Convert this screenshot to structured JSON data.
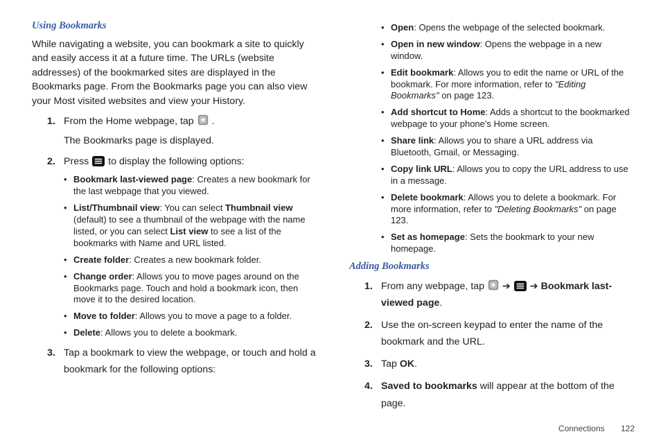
{
  "left": {
    "heading": "Using Bookmarks",
    "intro": "While navigating a website, you can bookmark a site to quickly and easily access it at a future time. The URLs (website addresses) of the bookmarked sites are displayed in the Bookmarks page. From the Bookmarks page you can also view your Most visited websites and view your History.",
    "step1a": "From the Home webpage, tap ",
    "step1b": ".",
    "step1c": "The Bookmarks page is displayed.",
    "step2a": "Press ",
    "step2b": " to display the following options:",
    "b1_bold": "Bookmark last-viewed page",
    "b1_rest": ": Creates a new bookmark for the last webpage that you viewed.",
    "b2_bold1": "List/Thumbnail view",
    "b2_rest1": ": You can select ",
    "b2_bold2": "Thumbnail view",
    "b2_rest2": " (default) to see a thumbnail of the webpage with the name listed, or you can select ",
    "b2_bold3": "List view",
    "b2_rest3": " to see a list of the bookmarks with Name and URL listed.",
    "b3_bold": "Create folder",
    "b3_rest": ": Creates a new bookmark folder.",
    "b4_bold": "Change order",
    "b4_rest": ": Allows you to move pages around on the Bookmarks page. Touch and hold a bookmark icon, then move it to the desired location.",
    "b5_bold": "Move to folder",
    "b5_rest": ": Allows you to move a page to a folder.",
    "b6_bold": "Delete",
    "b6_rest": ": Allows you to delete a bookmark.",
    "step3": "Tap a bookmark to view the webpage, or touch and hold a bookmark for the following options:"
  },
  "right": {
    "r1_bold": "Open",
    "r1_rest": ": Opens the webpage of the selected bookmark.",
    "r2_bold": "Open in new window",
    "r2_rest": ": Opens the webpage in a new window.",
    "r3_bold": "Edit bookmark",
    "r3_rest1": ": Allows you to edit the name or URL of the bookmark. For more information, refer to ",
    "r3_ital": "\"Editing Bookmarks\"",
    "r3_rest2": " on page 123.",
    "r4_bold": "Add shortcut to Home",
    "r4_rest": ": Adds a shortcut to the bookmarked webpage to your phone's Home screen.",
    "r5_bold": "Share link",
    "r5_rest": ": Allows you to share a URL address via Bluetooth, Gmail, or Messaging.",
    "r6_bold": "Copy link URL",
    "r6_rest": ": Allows you to copy the URL address to use in a message.",
    "r7_bold": "Delete bookmark",
    "r7_rest1": ": Allows you to delete a bookmark. For more information, refer to ",
    "r7_ital": "\"Deleting Bookmarks\" ",
    "r7_rest2": " on page 123.",
    "r8_bold": "Set as homepage",
    "r8_rest": ": Sets the bookmark to your new homepage.",
    "heading2": "Adding Bookmarks",
    "a1a": "From any webpage, tap ",
    "a1b": " ➔ ",
    "a1c": " ➔ ",
    "a1_bold": "Bookmark last-viewed page",
    "a1d": ".",
    "a2": "Use the on-screen keypad to enter the name of the bookmark and the URL.",
    "a3a": "Tap ",
    "a3_bold": "OK",
    "a3b": ".",
    "a4_bold": "Saved to bookmarks",
    "a4_rest": " will appear at the bottom of the page."
  },
  "footer": {
    "section": "Connections",
    "page": "122"
  }
}
